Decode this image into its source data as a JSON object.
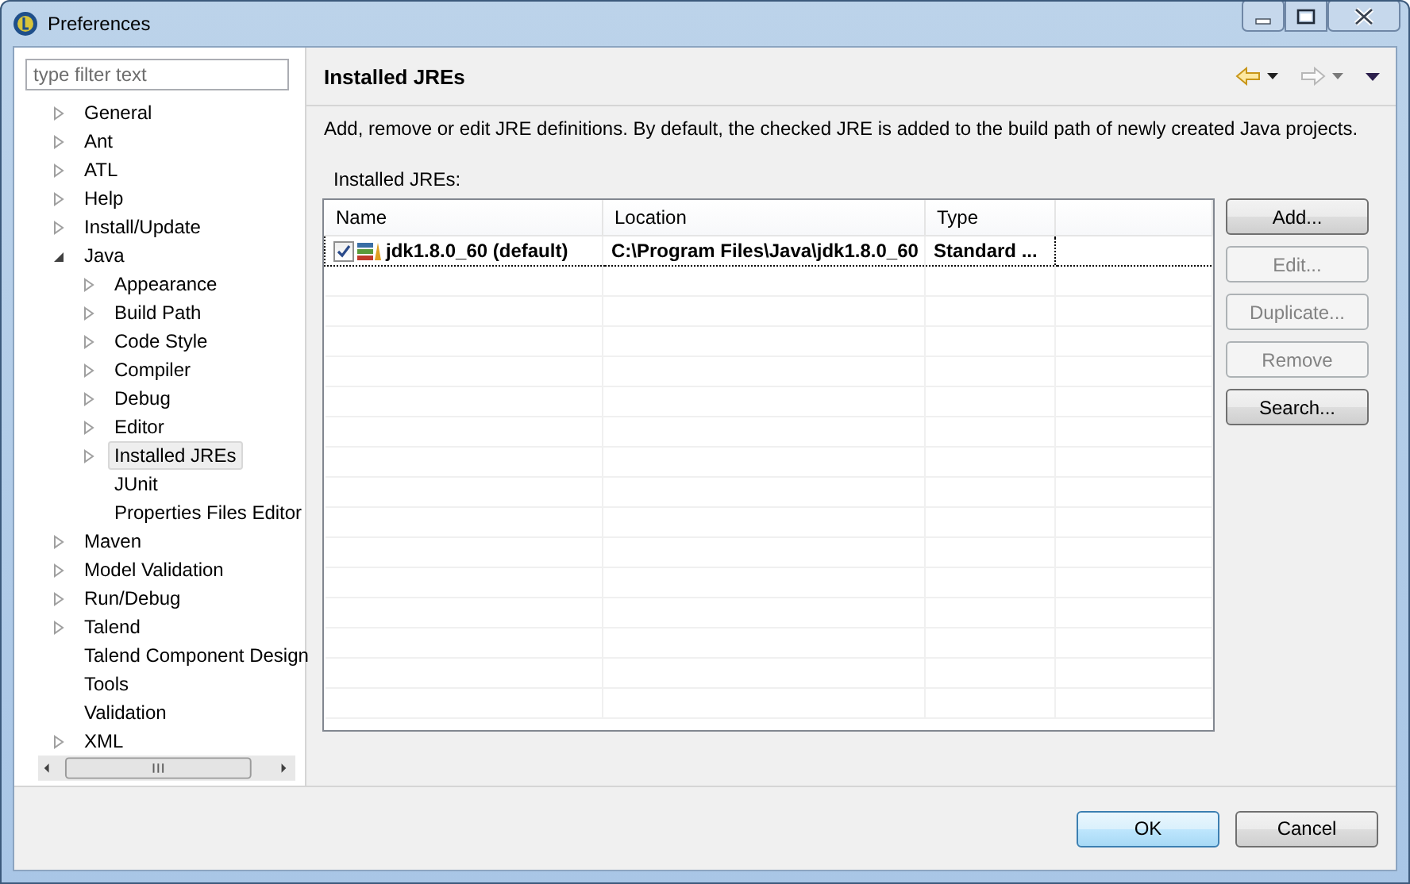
{
  "window": {
    "title": "Preferences"
  },
  "filter": {
    "placeholder": "type filter text"
  },
  "tree": [
    {
      "label": "General",
      "expandable": true,
      "expanded": false,
      "selected": false
    },
    {
      "label": "Ant",
      "expandable": true,
      "expanded": false,
      "selected": false
    },
    {
      "label": "ATL",
      "expandable": true,
      "expanded": false,
      "selected": false
    },
    {
      "label": "Help",
      "expandable": true,
      "expanded": false,
      "selected": false
    },
    {
      "label": "Install/Update",
      "expandable": true,
      "expanded": false,
      "selected": false
    },
    {
      "label": "Java",
      "expandable": true,
      "expanded": true,
      "selected": false,
      "children": [
        {
          "label": "Appearance",
          "expandable": true,
          "expanded": false,
          "selected": false
        },
        {
          "label": "Build Path",
          "expandable": true,
          "expanded": false,
          "selected": false
        },
        {
          "label": "Code Style",
          "expandable": true,
          "expanded": false,
          "selected": false
        },
        {
          "label": "Compiler",
          "expandable": true,
          "expanded": false,
          "selected": false
        },
        {
          "label": "Debug",
          "expandable": true,
          "expanded": false,
          "selected": false
        },
        {
          "label": "Editor",
          "expandable": true,
          "expanded": false,
          "selected": false
        },
        {
          "label": "Installed JREs",
          "expandable": true,
          "expanded": false,
          "selected": true
        },
        {
          "label": "JUnit",
          "selected": false
        },
        {
          "label": "Properties Files Editor",
          "selected": false
        }
      ]
    },
    {
      "label": "Maven",
      "expandable": true,
      "expanded": false,
      "selected": false
    },
    {
      "label": "Model Validation",
      "expandable": true,
      "expanded": false,
      "selected": false
    },
    {
      "label": "Run/Debug",
      "expandable": true,
      "expanded": false,
      "selected": false
    },
    {
      "label": "Talend",
      "expandable": true,
      "expanded": false,
      "selected": false
    },
    {
      "label": "Talend Component Design",
      "selected": false
    },
    {
      "label": "Tools",
      "selected": false
    },
    {
      "label": "Validation",
      "selected": false
    },
    {
      "label": "XML",
      "expandable": true,
      "expanded": false,
      "selected": false
    }
  ],
  "page": {
    "title": "Installed JREs",
    "history_buttons": [
      {
        "kind": "back",
        "disabled": false
      },
      {
        "kind": "forward",
        "disabled": true
      }
    ],
    "description": "Add, remove or edit JRE definitions. By default, the checked JRE is added to the build path of newly created Java projects.",
    "table_label": "Installed JREs:",
    "table": {
      "columns": [
        "Name",
        "Location",
        "Type"
      ],
      "rows": [
        {
          "checked": true,
          "selected": true,
          "cells": [
            "jdk1.8.0_60 (default)",
            "C:\\Program Files\\Java\\jdk1.8.0_60",
            "Standard ..."
          ]
        }
      ]
    },
    "buttons": [
      {
        "label": "Add...",
        "disabled": false
      },
      {
        "label": "Edit...",
        "disabled": true
      },
      {
        "label": "Duplicate...",
        "disabled": true
      },
      {
        "label": "Remove",
        "disabled": true
      },
      {
        "label": "Search...",
        "disabled": false
      }
    ]
  },
  "dialog_buttons": [
    {
      "label": "OK",
      "default": true
    },
    {
      "label": "Cancel",
      "default": false
    }
  ]
}
